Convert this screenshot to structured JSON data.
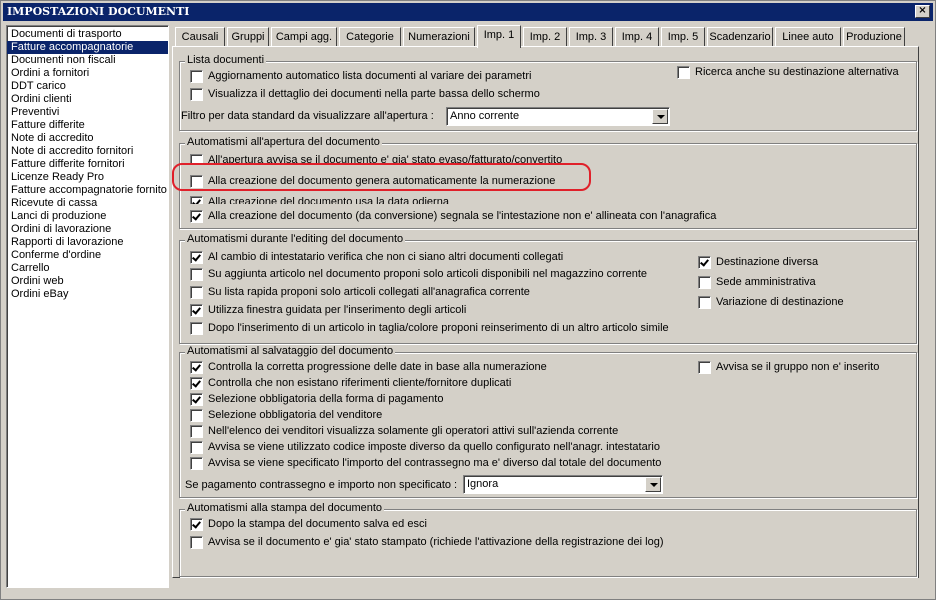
{
  "window": {
    "title": "IMPOSTAZIONI DOCUMENTI",
    "close_glyph": "×"
  },
  "doclist": [
    "Documenti di trasporto",
    "Fatture accompagnatorie",
    "Documenti non fiscali",
    "Ordini a fornitori",
    "DDT carico",
    "Ordini clienti",
    "Preventivi",
    "Fatture differite",
    "Note di accredito",
    "Note di accredito fornitori",
    "Fatture differite fornitori",
    "Licenze Ready Pro",
    "Fatture accompagnatorie fornito",
    "Ricevute di cassa",
    "Lanci di produzione",
    "Ordini di lavorazione",
    "Rapporti di lavorazione",
    "Conferme d'ordine",
    "Carrello",
    "Ordini web",
    "Ordini eBay"
  ],
  "doclist_selected": "Fatture accompagnatorie",
  "tabs": [
    "Causali",
    "Gruppi",
    "Campi agg.",
    "Categorie",
    "Numerazioni",
    "Imp. 1",
    "Imp. 2",
    "Imp. 3",
    "Imp. 4",
    "Imp. 5",
    "Scadenzario",
    "Linee auto",
    "Produzione"
  ],
  "active_tab": "Imp. 1",
  "lista": {
    "title": "Lista documenti",
    "opts": [
      {
        "label": "Aggiornamento automatico lista documenti al variare dei parametri",
        "checked": false
      },
      {
        "label": "Visualizza il dettaglio dei documenti nella parte bassa dello schermo",
        "checked": false
      },
      {
        "label": "Ricerca anche su destinazione alternativa",
        "checked": false
      }
    ],
    "filter_label": "Filtro per data standard da visualizzare all'apertura :",
    "filter_value": "Anno corrente"
  },
  "apertura": {
    "title": "Automatismi all'apertura del documento",
    "opts": [
      {
        "label": "All'apertura avvisa se il documento e' gia' stato evaso/fatturato/convertito",
        "checked": false
      },
      {
        "label": "Alla creazione del documento genera automaticamente la numerazione",
        "checked": false
      },
      {
        "label": "Alla creazione del documento usa la data odierna",
        "checked": true
      },
      {
        "label": "Alla creazione del documento (da conversione) segnala se l'intestazione non e' allineata con l'anagrafica",
        "checked": true
      }
    ]
  },
  "editing": {
    "title": "Automatismi durante l'editing del documento",
    "opts": [
      {
        "label": "Al cambio di intestatario verifica che non ci siano altri documenti collegati",
        "checked": true
      },
      {
        "label": "Su aggiunta articolo nel documento proponi solo articoli disponibili nel magazzino corrente",
        "checked": false
      },
      {
        "label": "Su lista rapida proponi solo articoli collegati all'anagrafica corrente",
        "checked": false
      },
      {
        "label": "Utilizza finestra guidata per l'inserimento degli articoli",
        "checked": true
      },
      {
        "label": "Dopo l'inserimento di un articolo in taglia/colore proponi reinserimento di un altro articolo simile",
        "checked": false
      }
    ],
    "right": [
      {
        "label": "Destinazione diversa",
        "checked": true
      },
      {
        "label": "Sede amministrativa",
        "checked": false
      },
      {
        "label": "Variazione di destinazione",
        "checked": false
      }
    ]
  },
  "salvataggio": {
    "title": "Automatismi al salvataggio del documento",
    "opts": [
      {
        "label": "Controlla la corretta progressione delle date in base alla numerazione",
        "checked": true
      },
      {
        "label": "Controlla che non esistano riferimenti cliente/fornitore duplicati",
        "checked": true
      },
      {
        "label": "Selezione obbligatoria della forma di pagamento",
        "checked": true
      },
      {
        "label": "Selezione obbligatoria del venditore",
        "checked": false
      },
      {
        "label": "Nell'elenco dei venditori visualizza solamente gli operatori attivi sull'azienda corrente",
        "checked": false
      },
      {
        "label": "Avvisa se viene utilizzato codice imposte diverso da quello configurato nell'anagr. intestatario",
        "checked": false
      },
      {
        "label": "Avvisa se viene specificato l'importo del contrassegno ma e' diverso dal totale del documento",
        "checked": false
      }
    ],
    "right": {
      "label": "Avvisa se il gruppo non e' inserito",
      "checked": false
    },
    "combo_label": "Se pagamento contrassegno e importo non specificato :",
    "combo_value": "Ignora"
  },
  "stampa": {
    "title": "Automatismi alla stampa del documento",
    "opts": [
      {
        "label": "Dopo la stampa del documento salva ed esci",
        "checked": true
      },
      {
        "label": "Avvisa se il documento e' gia' stato stampato (richiede l'attivazione della registrazione dei log)",
        "checked": false
      }
    ]
  }
}
